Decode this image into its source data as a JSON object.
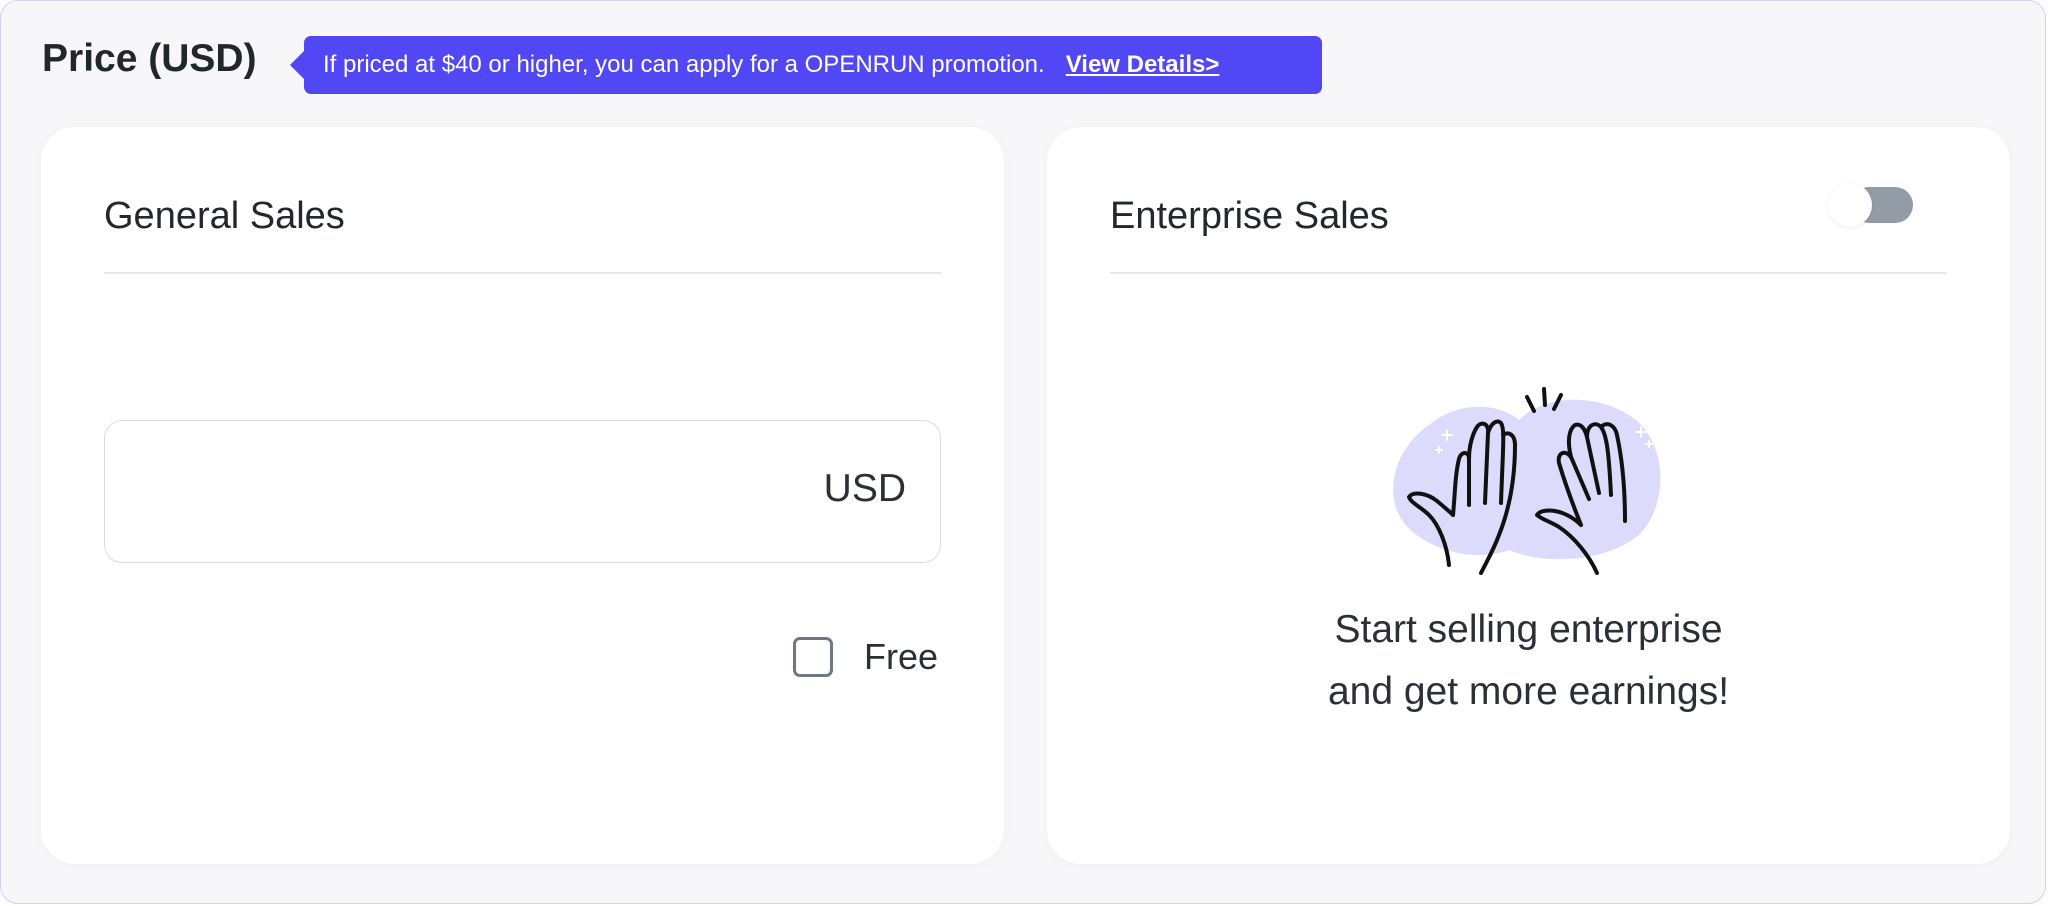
{
  "header": {
    "title": "Price (USD)",
    "promo_text": "If priced at $40 or higher, you can apply for a OPENRUN promotion.",
    "promo_link": "View Details>"
  },
  "general_sales": {
    "title": "General Sales",
    "price_value": "",
    "currency": "USD",
    "free_label": "Free",
    "free_checked": false
  },
  "enterprise_sales": {
    "title": "Enterprise Sales",
    "toggle_on": false,
    "illustration": "high-five-hands-icon",
    "message_line1": "Start selling enterprise",
    "message_line2": "and get more earnings!"
  },
  "colors": {
    "accent": "#5147f5",
    "toggle_off": "#929ba6",
    "illustration_bg": "#dcdbfb"
  }
}
